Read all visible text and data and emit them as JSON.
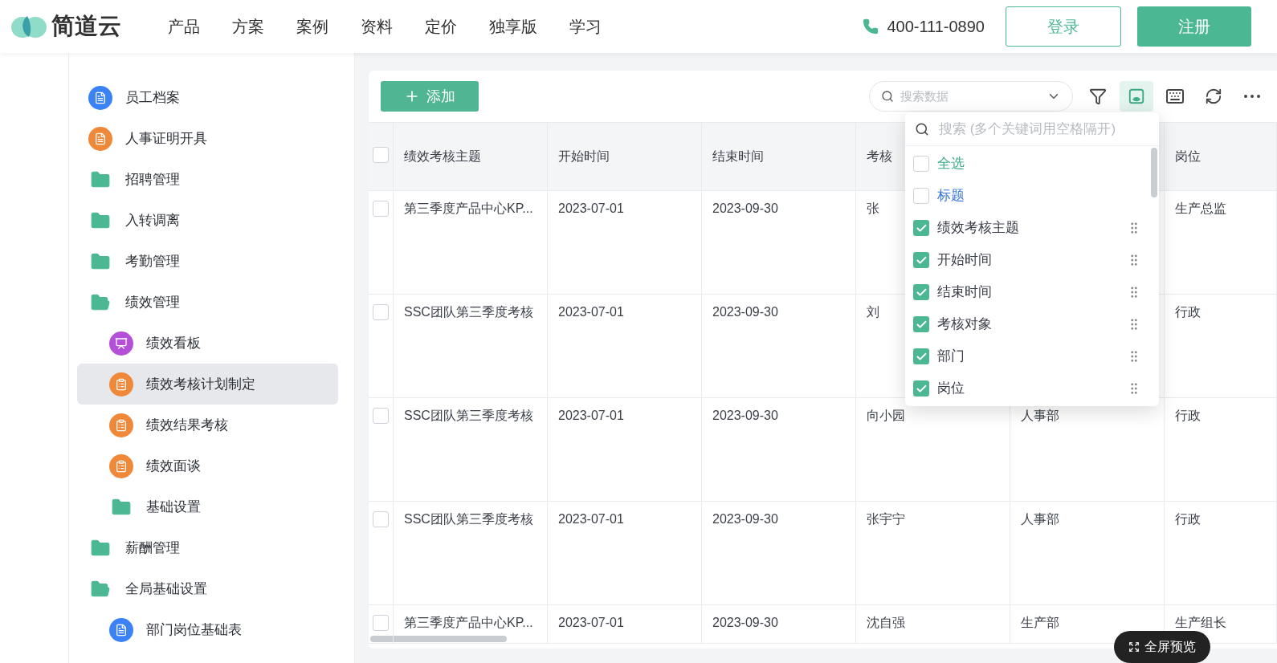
{
  "header": {
    "logo": "简道云",
    "nav": [
      "产品",
      "方案",
      "案例",
      "资料",
      "定价",
      "独享版",
      "学习"
    ],
    "phone": "400-111-0890",
    "login": "登录",
    "register": "注册"
  },
  "sidebar": {
    "items": [
      {
        "label": "员工档案",
        "kind": "doc",
        "color": "#3b82f6",
        "selected": false
      },
      {
        "label": "人事证明开具",
        "kind": "doc",
        "color": "#f0883a",
        "selected": false
      },
      {
        "label": "招聘管理",
        "kind": "folder",
        "color": "#4cb893",
        "selected": false
      },
      {
        "label": "入转调离",
        "kind": "folder",
        "color": "#4cb893",
        "selected": false
      },
      {
        "label": "考勤管理",
        "kind": "folder",
        "color": "#4cb893",
        "selected": false
      },
      {
        "label": "绩效管理",
        "kind": "folder",
        "color": "#4cb893",
        "selected": false,
        "expanded": true,
        "children": [
          {
            "label": "绩效看板",
            "kind": "chart",
            "color": "#b44fd8",
            "selected": false
          },
          {
            "label": "绩效考核计划制定",
            "kind": "clipboard",
            "color": "#f0883a",
            "selected": true
          },
          {
            "label": "绩效结果考核",
            "kind": "clipboard",
            "color": "#f0883a",
            "selected": false
          },
          {
            "label": "绩效面谈",
            "kind": "clipboard",
            "color": "#f0883a",
            "selected": false
          },
          {
            "label": "基础设置",
            "kind": "folder",
            "color": "#4cb893",
            "selected": false
          }
        ]
      },
      {
        "label": "薪酬管理",
        "kind": "folder",
        "color": "#4cb893",
        "selected": false
      },
      {
        "label": "全局基础设置",
        "kind": "folder",
        "color": "#4cb893",
        "selected": false,
        "expanded": true,
        "children": [
          {
            "label": "部门岗位基础表",
            "kind": "doc",
            "color": "#3b82f6",
            "selected": false
          }
        ]
      }
    ]
  },
  "toolbar": {
    "add": "添加",
    "search_placeholder": "搜索数据",
    "buttons": [
      {
        "kind": "filter",
        "selected": false
      },
      {
        "kind": "fields",
        "selected": true
      },
      {
        "kind": "keyboard",
        "selected": false
      },
      {
        "kind": "refresh",
        "selected": false
      },
      {
        "kind": "more",
        "selected": false
      }
    ]
  },
  "table": {
    "header_checked": false,
    "columns": [
      "绩效考核主题",
      "开始时间",
      "结束时间",
      "考核",
      null,
      "岗位"
    ],
    "rows": [
      {
        "checked": false,
        "cells": [
          "第三季度产品中心KP...",
          "2023-07-01",
          "2023-09-30",
          "张",
          null,
          "生产总监"
        ]
      },
      {
        "checked": false,
        "cells": [
          "SSC团队第三季度考核",
          "2023-07-01",
          "2023-09-30",
          "刘",
          null,
          "行政"
        ]
      },
      {
        "checked": false,
        "cells": [
          "SSC团队第三季度考核",
          "2023-07-01",
          "2023-09-30",
          "向小园",
          "人事部",
          "行政"
        ]
      },
      {
        "checked": false,
        "cells": [
          "SSC团队第三季度考核",
          "2023-07-01",
          "2023-09-30",
          "张宇宁",
          "人事部",
          "行政"
        ]
      },
      {
        "checked": false,
        "cells": [
          "第三季度产品中心KP...",
          "2023-07-01",
          "2023-09-30",
          "沈自强",
          "生产部",
          "生产组长"
        ]
      }
    ]
  },
  "column_picker": {
    "search_placeholder": "搜索 (多个关键词用空格隔开)",
    "items": [
      {
        "label": "全选",
        "kind": "select_all",
        "checked": false
      },
      {
        "label": "标题",
        "kind": "title",
        "checked": false
      },
      {
        "label": "绩效考核主题",
        "kind": "column",
        "checked": true
      },
      {
        "label": "开始时间",
        "kind": "column",
        "checked": true
      },
      {
        "label": "结束时间",
        "kind": "column",
        "checked": true
      },
      {
        "label": "考核对象",
        "kind": "column",
        "checked": true
      },
      {
        "label": "部门",
        "kind": "column",
        "checked": true
      },
      {
        "label": "岗位",
        "kind": "column",
        "checked": true
      }
    ]
  },
  "fullscreen_button": "全屏预览"
}
